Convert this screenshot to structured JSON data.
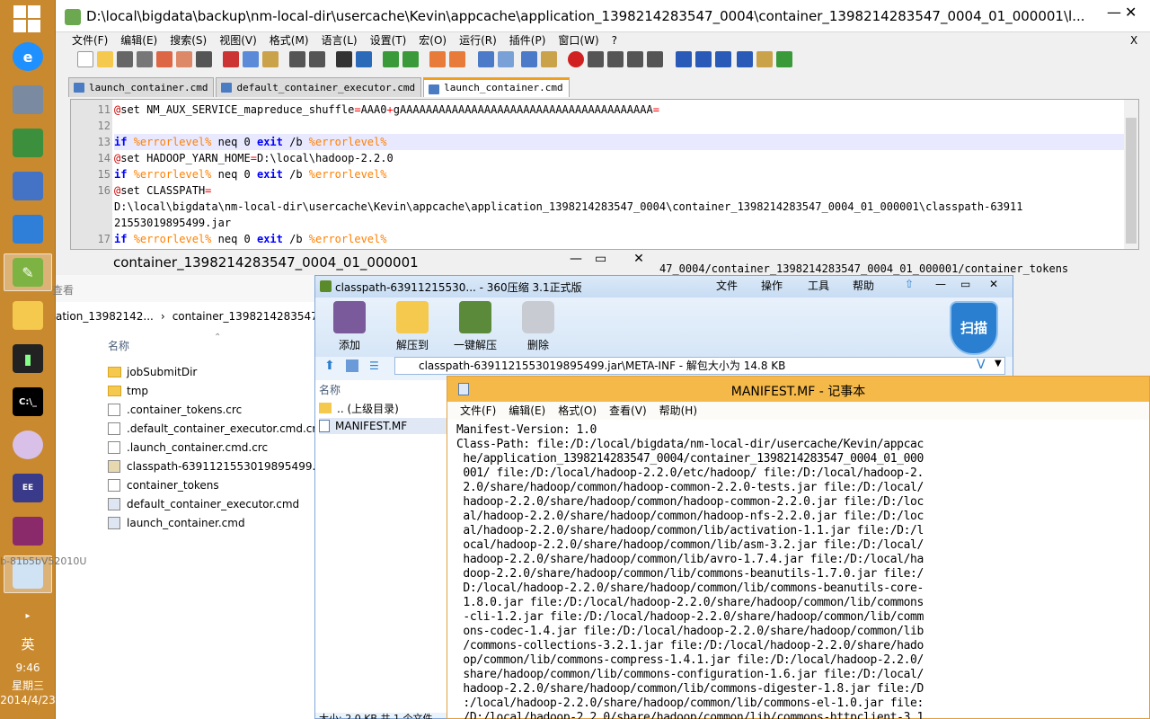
{
  "taskbar": {
    "tray_lang": "英",
    "tray_time": "9:46",
    "tray_day": "星期三",
    "tray_date": "2014/4/23"
  },
  "notepadpp": {
    "title": "D:\\local\\bigdata\\backup\\nm-local-dir\\usercache\\Kevin\\appcache\\application_1398214283547_0004\\container_1398214283547_0004_01_000001\\l...",
    "menu": [
      "文件(F)",
      "编辑(E)",
      "搜索(S)",
      "视图(V)",
      "格式(M)",
      "语言(L)",
      "设置(T)",
      "宏(O)",
      "运行(R)",
      "插件(P)",
      "窗口(W)",
      "?"
    ],
    "menu_close": "X",
    "tabs": [
      "launch_container.cmd",
      "default_container_executor.cmd",
      "launch_container.cmd"
    ],
    "lines": [
      {
        "num": "11",
        "segments": [
          [
            "at",
            "@"
          ],
          [
            "kw2",
            "set"
          ],
          [
            "txt",
            " NM_AUX_SERVICE_mapreduce_shuffle"
          ],
          [
            "op",
            "="
          ],
          [
            "txt",
            "AAA0"
          ],
          [
            "op",
            "+"
          ],
          [
            "txt",
            "gAAAAAAAAAAAAAAAAAAAAAAAAAAAAAAAAAAAAAAA"
          ],
          [
            "op",
            "="
          ]
        ]
      },
      {
        "num": "12",
        "segments": []
      },
      {
        "num": "13",
        "segments": [
          [
            "kw",
            "if"
          ],
          [
            "txt",
            " "
          ],
          [
            "var",
            "%errorlevel%"
          ],
          [
            "txt",
            " neq 0 "
          ],
          [
            "kw",
            "exit"
          ],
          [
            "txt",
            " /b "
          ],
          [
            "var",
            "%errorlevel%"
          ]
        ]
      },
      {
        "num": "14",
        "segments": [
          [
            "at",
            "@"
          ],
          [
            "kw2",
            "set"
          ],
          [
            "txt",
            " HADOOP_YARN_HOME"
          ],
          [
            "op",
            "="
          ],
          [
            "txt",
            "D:\\local\\hadoop-2.2.0"
          ]
        ]
      },
      {
        "num": "15",
        "segments": [
          [
            "kw",
            "if"
          ],
          [
            "txt",
            " "
          ],
          [
            "var",
            "%errorlevel%"
          ],
          [
            "txt",
            " neq 0 "
          ],
          [
            "kw",
            "exit"
          ],
          [
            "txt",
            " /b "
          ],
          [
            "var",
            "%errorlevel%"
          ]
        ]
      },
      {
        "num": "16",
        "segments": [
          [
            "at",
            "@"
          ],
          [
            "kw2",
            "set"
          ],
          [
            "txt",
            " CLASSPATH"
          ],
          [
            "op",
            "="
          ]
        ]
      },
      {
        "num": "",
        "segments": [
          [
            "txt",
            "D:\\local\\bigdata\\nm-local-dir\\usercache\\Kevin\\appcache\\application_1398214283547_0004\\container_1398214283547_0004_01_000001\\classpath-63911"
          ]
        ]
      },
      {
        "num": "",
        "segments": [
          [
            "txt",
            "21553019895499.jar"
          ]
        ]
      },
      {
        "num": "17",
        "segments": [
          [
            "kw",
            "if"
          ],
          [
            "txt",
            " "
          ],
          [
            "var",
            "%errorlevel%"
          ],
          [
            "txt",
            " neq 0 "
          ],
          [
            "kw",
            "exit"
          ],
          [
            "txt",
            " /b "
          ],
          [
            "var",
            "%errorlevel%"
          ]
        ]
      }
    ],
    "overflow_text": "47_0004/container_1398214283547_0004_01_000001/container_tokens"
  },
  "explorer": {
    "title": "container_1398214283547_0004_01_000001",
    "ribbon_label": "查看",
    "breadcrumb_prev": "ation_13982142...",
    "breadcrumb_current": "container_1398214283547_0004",
    "column_name": "名称",
    "side_text": "b-81b5bV52010U",
    "items": [
      {
        "name": "jobSubmitDir",
        "type": "folder"
      },
      {
        "name": "tmp",
        "type": "folder"
      },
      {
        "name": ".container_tokens.crc",
        "type": "file"
      },
      {
        "name": ".default_container_executor.cmd.crc",
        "type": "file"
      },
      {
        "name": ".launch_container.cmd.crc",
        "type": "file"
      },
      {
        "name": "classpath-6391121553019895499.jar",
        "type": "jar"
      },
      {
        "name": "container_tokens",
        "type": "file"
      },
      {
        "name": "default_container_executor.cmd",
        "type": "cmd"
      },
      {
        "name": "launch_container.cmd",
        "type": "cmd"
      }
    ]
  },
  "zip": {
    "title": "classpath-63911215530... - 360压缩 3.1正式版",
    "menu": [
      "文件",
      "操作",
      "工具",
      "帮助"
    ],
    "buttons": [
      "添加",
      "解压到",
      "一键解压",
      "删除"
    ],
    "scan": "扫描",
    "address": "classpath-6391121553019895499.jar\\META-INF - 解包大小为 14.8 KB",
    "column_name": "名称",
    "rows": [
      ".. (上级目录)",
      "MANIFEST.MF"
    ],
    "status": "大小: 2.0 KB 共 1 个文件"
  },
  "notepad": {
    "title": "MANIFEST.MF - 记事本",
    "menu": [
      "文件(F)",
      "编辑(E)",
      "格式(O)",
      "查看(V)",
      "帮助(H)"
    ],
    "lines": [
      "Manifest-Version: 1.0",
      "Class-Path: file:/D:/local/bigdata/nm-local-dir/usercache/Kevin/appcac",
      " he/application_1398214283547_0004/container_1398214283547_0004_01_000",
      " 001/ file:/D:/local/hadoop-2.2.0/etc/hadoop/ file:/D:/local/hadoop-2.",
      " 2.0/share/hadoop/common/hadoop-common-2.2.0-tests.jar file:/D:/local/",
      " hadoop-2.2.0/share/hadoop/common/hadoop-common-2.2.0.jar file:/D:/loc",
      " al/hadoop-2.2.0/share/hadoop/common/hadoop-nfs-2.2.0.jar file:/D:/loc",
      " al/hadoop-2.2.0/share/hadoop/common/lib/activation-1.1.jar file:/D:/l",
      " ocal/hadoop-2.2.0/share/hadoop/common/lib/asm-3.2.jar file:/D:/local/",
      " hadoop-2.2.0/share/hadoop/common/lib/avro-1.7.4.jar file:/D:/local/ha",
      " doop-2.2.0/share/hadoop/common/lib/commons-beanutils-1.7.0.jar file:/",
      " D:/local/hadoop-2.2.0/share/hadoop/common/lib/commons-beanutils-core-",
      " 1.8.0.jar file:/D:/local/hadoop-2.2.0/share/hadoop/common/lib/commons",
      " -cli-1.2.jar file:/D:/local/hadoop-2.2.0/share/hadoop/common/lib/comm",
      " ons-codec-1.4.jar file:/D:/local/hadoop-2.2.0/share/hadoop/common/lib",
      " /commons-collections-3.2.1.jar file:/D:/local/hadoop-2.2.0/share/hado",
      " op/common/lib/commons-compress-1.4.1.jar file:/D:/local/hadoop-2.2.0/",
      " share/hadoop/common/lib/commons-configuration-1.6.jar file:/D:/local/",
      " hadoop-2.2.0/share/hadoop/common/lib/commons-digester-1.8.jar file:/D",
      " :/local/hadoop-2.2.0/share/hadoop/common/lib/commons-el-1.0.jar file:",
      " /D:/local/hadoop-2.2.0/share/hadoop/common/lib/commons-httpclient-3.1"
    ]
  }
}
